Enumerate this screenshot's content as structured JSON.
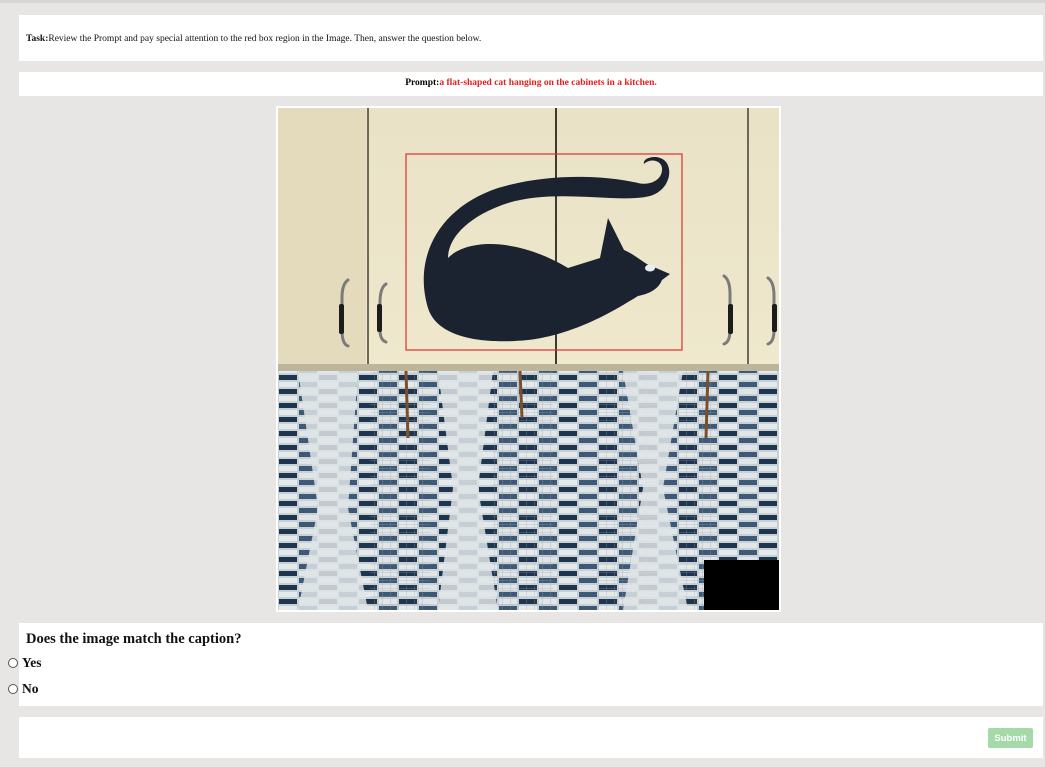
{
  "task": {
    "label": "Task:",
    "text": "Review the Prompt and pay special attention to the red box region in the Image. Then, answer the question below."
  },
  "prompt": {
    "label": "Prompt:",
    "text": "a flat-shaped cat hanging on the cabinets in a kitchen."
  },
  "image": {
    "highlight_color": "#e03030"
  },
  "question": {
    "text": "Does the image match the caption?",
    "options": [
      {
        "label": "Yes",
        "selected": false
      },
      {
        "label": "No",
        "selected": false
      }
    ]
  },
  "submit": {
    "label": "Submit",
    "color": "#a6d9a8"
  },
  "colors": {
    "page_background": "#e7e6e4",
    "prompt_text": "#e02020"
  }
}
